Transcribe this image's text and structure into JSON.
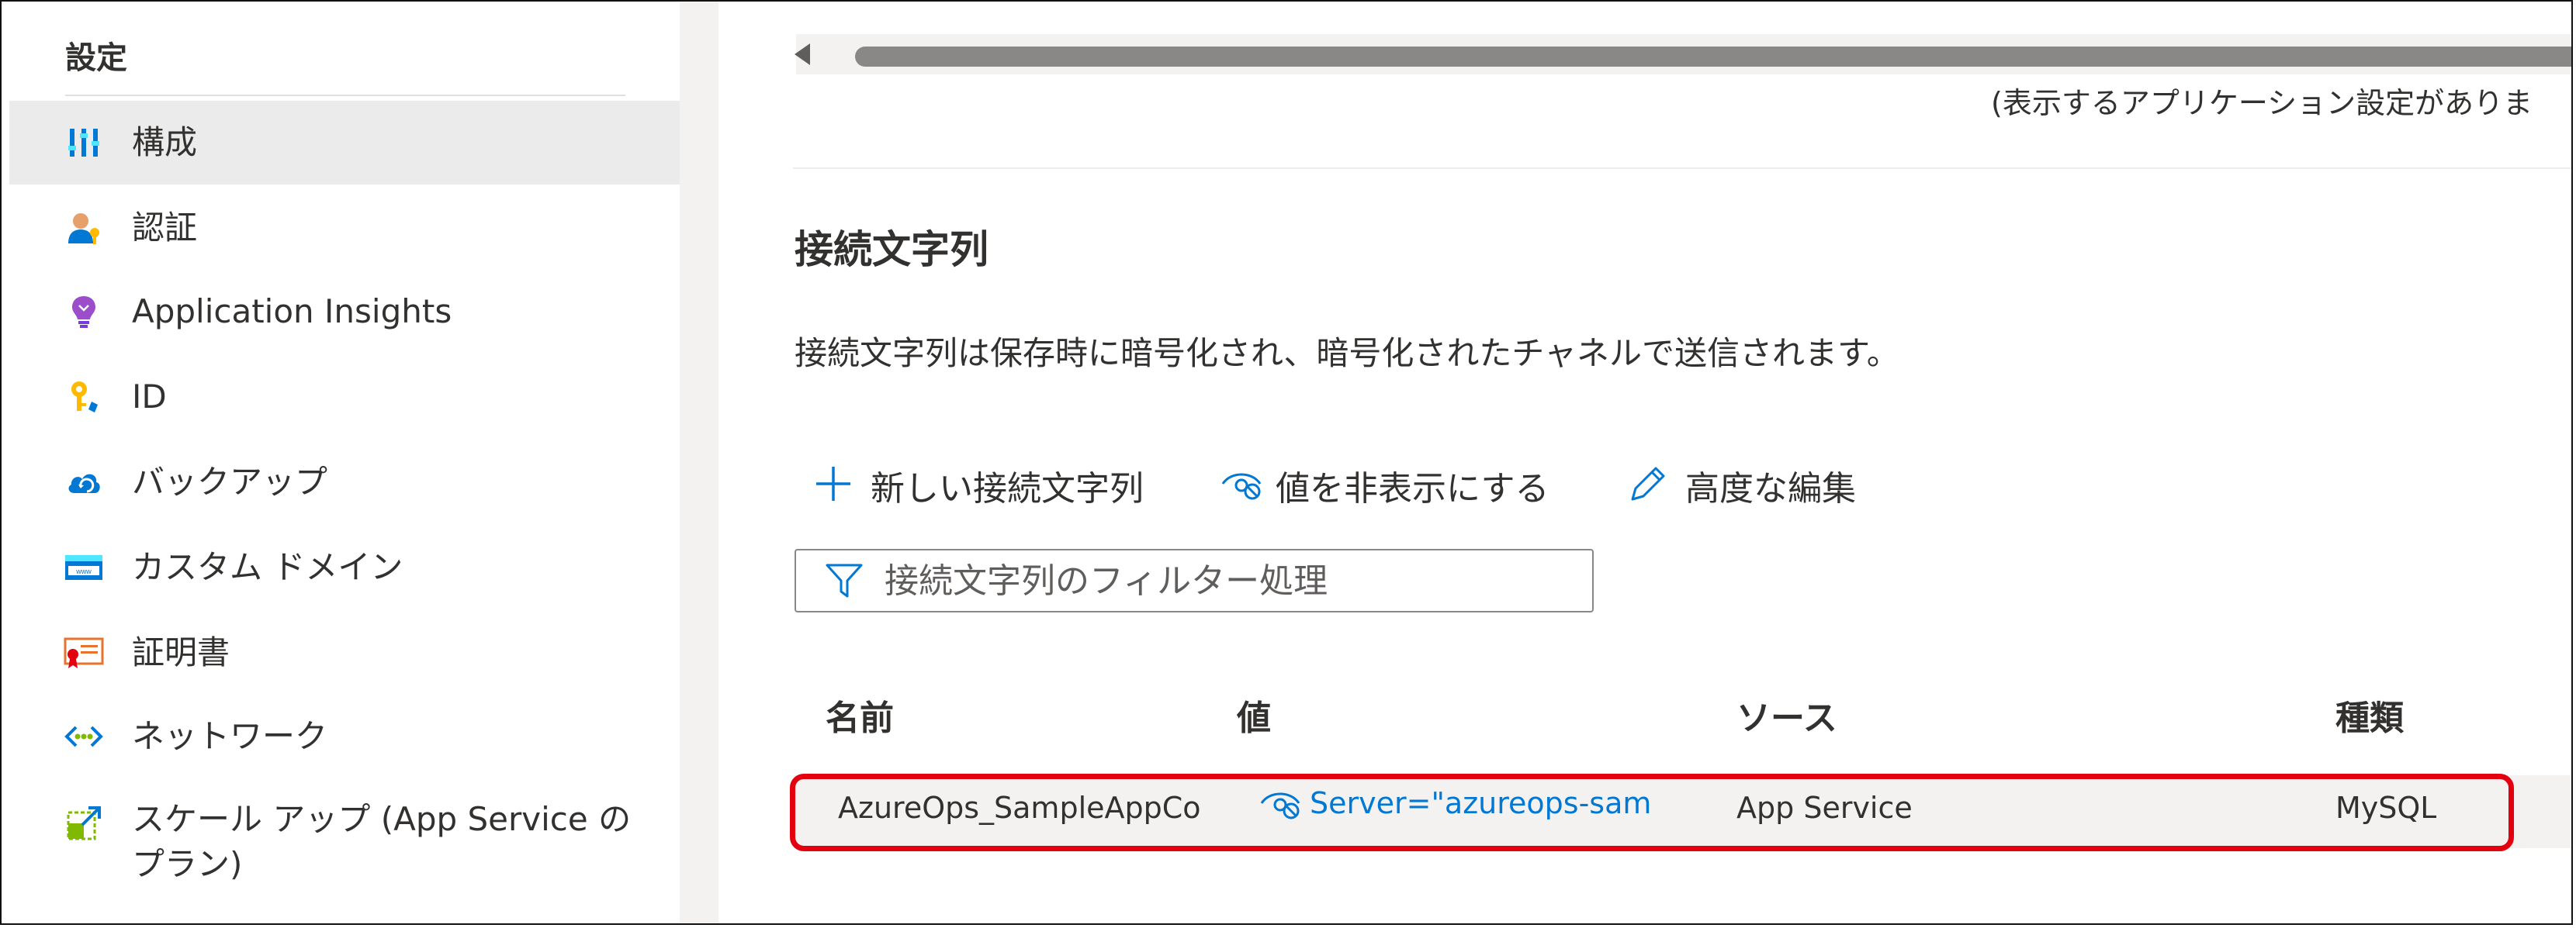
{
  "sidebar": {
    "heading": "設定",
    "items": [
      {
        "label": "構成",
        "icon": "configuration-icon",
        "active": true
      },
      {
        "label": "認証",
        "icon": "authentication-icon"
      },
      {
        "label": "Application Insights",
        "icon": "application-insights-icon"
      },
      {
        "label": "ID",
        "icon": "identity-icon"
      },
      {
        "label": "バックアップ",
        "icon": "backup-icon"
      },
      {
        "label": "カスタム ドメイン",
        "icon": "custom-domain-icon"
      },
      {
        "label": "証明書",
        "icon": "certificate-icon"
      },
      {
        "label": "ネットワーク",
        "icon": "network-icon"
      },
      {
        "label": "スケール アップ (App Service のプラン)",
        "icon": "scale-up-icon"
      }
    ]
  },
  "app_settings": {
    "empty_message": "(表示するアプリケーション設定がありま"
  },
  "connection_strings": {
    "title": "接続文字列",
    "description": "接続文字列は保存時に暗号化され、暗号化されたチャネルで送信されます。",
    "toolbar": {
      "new_label": "新しい接続文字列",
      "hide_values_label": "値を非表示にする",
      "advanced_edit_label": "高度な編集"
    },
    "filter_placeholder": "接続文字列のフィルター処理",
    "columns": [
      "名前",
      "値",
      "ソース",
      "種類"
    ],
    "rows": [
      {
        "name": "AzureOps_SampleAppCon",
        "value": "Server=\"azureops-sampleap",
        "source": "App Service",
        "type": "MySQL"
      }
    ]
  },
  "colors": {
    "accent": "#0078d4",
    "highlight": "#e3000f",
    "active_nav": "#ebebeb"
  }
}
